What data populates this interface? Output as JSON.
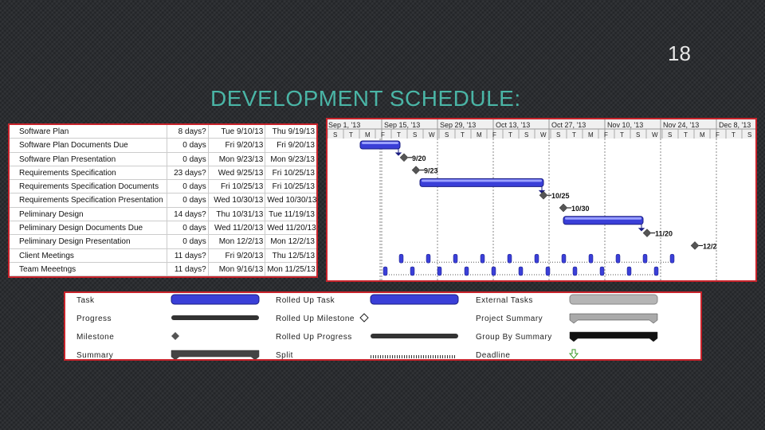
{
  "slide_number": "18",
  "title": "DEVELOPMENT SCHEDULE:",
  "tasks": [
    {
      "name": "Software Plan",
      "duration": "8 days?",
      "start": "Tue 9/10/13",
      "finish": "Thu 9/19/13"
    },
    {
      "name": "Software Plan Documents Due",
      "duration": "0 days",
      "start": "Fri 9/20/13",
      "finish": "Fri 9/20/13"
    },
    {
      "name": "Software Plan Presentation",
      "duration": "0 days",
      "start": "Mon 9/23/13",
      "finish": "Mon 9/23/13"
    },
    {
      "name": "Requirements Specification",
      "duration": "23 days?",
      "start": "Wed 9/25/13",
      "finish": "Fri 10/25/13"
    },
    {
      "name": "Requirements Specification Documents",
      "duration": "0 days",
      "start": "Fri 10/25/13",
      "finish": "Fri 10/25/13"
    },
    {
      "name": "Requirements Specification Presentation",
      "duration": "0 days",
      "start": "Wed 10/30/13",
      "finish": "Wed 10/30/13"
    },
    {
      "name": "Peliminary Design",
      "duration": "14 days?",
      "start": "Thu 10/31/13",
      "finish": "Tue 11/19/13"
    },
    {
      "name": "Peliminary Design Documents Due",
      "duration": "0 days",
      "start": "Wed 11/20/13",
      "finish": "Wed 11/20/13"
    },
    {
      "name": "Peliminary Design Presentation",
      "duration": "0 days",
      "start": "Mon 12/2/13",
      "finish": "Mon 12/2/13"
    },
    {
      "name": "Client Meetings",
      "duration": "11 days?",
      "start": "Fri 9/20/13",
      "finish": "Thu 12/5/13"
    },
    {
      "name": "Team Meeetngs",
      "duration": "11 days?",
      "start": "Mon 9/16/13",
      "finish": "Mon 11/25/13"
    }
  ],
  "gantt": {
    "periods": [
      "Sep 1, '13",
      "Sep 15, '13",
      "Sep 29, '13",
      "Oct 13, '13",
      "Oct 27, '13",
      "Nov 10, '13",
      "Nov 24, '13",
      "Dec 8, '13"
    ],
    "day_letters": [
      "S",
      "T",
      "M",
      "F",
      "T",
      "S",
      "W",
      "S",
      "T",
      "M",
      "F",
      "T",
      "S",
      "W",
      "S",
      "T",
      "M",
      "F",
      "T",
      "S",
      "W",
      "S",
      "T",
      "M",
      "F",
      "T",
      "S"
    ],
    "milestone_labels": [
      "9/20",
      "9/23",
      "10/25",
      "10/30",
      "11/20",
      "12/2"
    ],
    "task_color": "#3a3fd8",
    "milestone_color": "#555555"
  },
  "legend": [
    {
      "label": "Task",
      "symbol": "task"
    },
    {
      "label": "Progress",
      "symbol": "progress"
    },
    {
      "label": "Milestone",
      "symbol": "milestone"
    },
    {
      "label": "Summary",
      "symbol": "summary"
    },
    {
      "label": "Rolled Up Task",
      "symbol": "task"
    },
    {
      "label": "Rolled Up Milestone",
      "symbol": "hollow-milestone"
    },
    {
      "label": "Rolled Up Progress",
      "symbol": "progress"
    },
    {
      "label": "Split",
      "symbol": "split"
    },
    {
      "label": "External Tasks",
      "symbol": "external"
    },
    {
      "label": "Project Summary",
      "symbol": "project-summary"
    },
    {
      "label": "Group By Summary",
      "symbol": "group-summary"
    },
    {
      "label": "Deadline",
      "symbol": "deadline"
    }
  ]
}
